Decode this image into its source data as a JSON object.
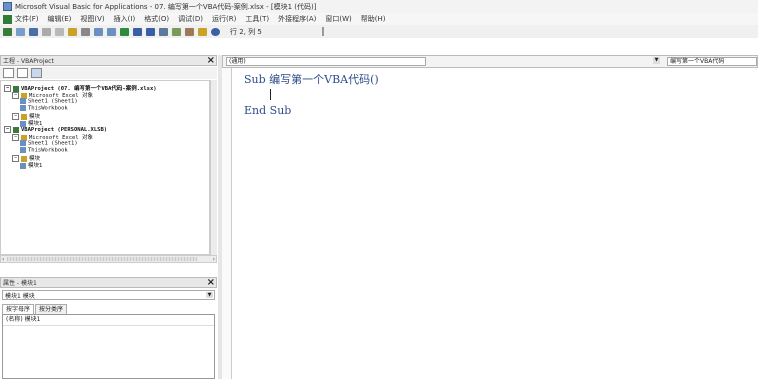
{
  "window": {
    "title": "Microsoft Visual Basic for Applications - 07. 编写第一个VBA代码-案例.xlsx - [模块1 (代码)]"
  },
  "menu": {
    "items": [
      "文件(F)",
      "编辑(E)",
      "视图(V)",
      "插入(I)",
      "格式(O)",
      "调试(D)",
      "运行(R)",
      "工具(T)",
      "外接程序(A)",
      "窗口(W)",
      "帮助(H)"
    ]
  },
  "toolbar": {
    "position": "行 2, 列 5"
  },
  "project_pane": {
    "title": "工程 - VBAProject",
    "close": "×",
    "tree": [
      {
        "label": "VBAProject (07. 编写第一个VBA代码-案例.xlsx)",
        "level": 0,
        "bold": true,
        "expander": "−"
      },
      {
        "label": "Microsoft Excel 对象",
        "level": 1,
        "expander": "−"
      },
      {
        "label": "Sheet1 (Sheet1)",
        "level": 2
      },
      {
        "label": "ThisWorkbook",
        "level": 2
      },
      {
        "label": "模块",
        "level": 1,
        "expander": "−"
      },
      {
        "label": "模块1",
        "level": 2
      },
      {
        "label": "VBAProject (PERSONAL.XLSB)",
        "level": 0,
        "bold": true,
        "expander": "−"
      },
      {
        "label": "Microsoft Excel 对象",
        "level": 1,
        "expander": "−"
      },
      {
        "label": "Sheet1 (Sheet1)",
        "level": 2
      },
      {
        "label": "ThisWorkbook",
        "level": 2
      },
      {
        "label": "模块",
        "level": 1,
        "expander": "−"
      },
      {
        "label": "模块1",
        "level": 2
      }
    ]
  },
  "properties_pane": {
    "title": "属性 - 模块1",
    "close": "×",
    "object_combo": "模块1 模块",
    "tabs": [
      "按字母序",
      "按分类序"
    ],
    "rows": [
      "(名称) 模块1"
    ]
  },
  "code_window": {
    "object_combo": "(通用)",
    "proc_combo": "编写第一个VBA代码",
    "lines": [
      "Sub 编写第一个VBA代码()",
      "",
      "End Sub"
    ]
  },
  "colors": {
    "keyword": "#2d4d8c",
    "project_icon": "#3a7a3a",
    "module_icon": "#c9a227"
  }
}
